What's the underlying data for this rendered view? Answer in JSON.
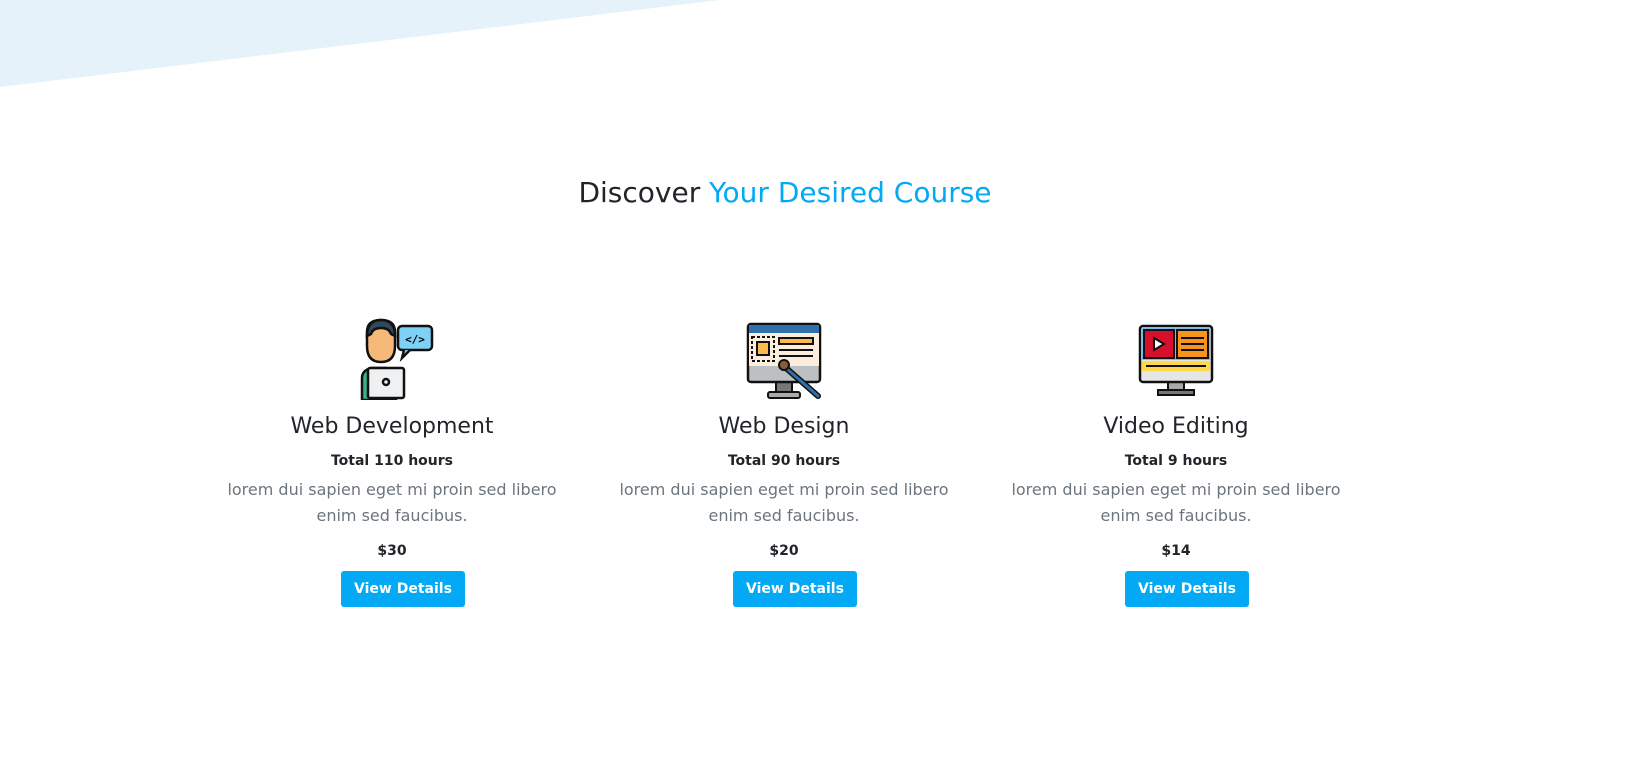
{
  "colors": {
    "accent": "#03a9f4",
    "background_shape": "#e6f2f9"
  },
  "section": {
    "title_plain": "Discover",
    "title_accent": "Your Desired Course"
  },
  "courses": [
    {
      "icon": "developer-laptop-icon",
      "title": "Web Development",
      "hours": "Total 110 hours",
      "description": "lorem dui sapien eget mi proin sed libero enim sed faucibus.",
      "price": "$30",
      "button": "View Details"
    },
    {
      "icon": "web-design-monitor-icon",
      "title": "Web Design",
      "hours": "Total 90 hours",
      "description": "lorem dui sapien eget mi proin sed libero enim sed faucibus.",
      "price": "$20",
      "button": "View Details"
    },
    {
      "icon": "video-editing-monitor-icon",
      "title": "Video Editing",
      "hours": "Total 9 hours",
      "description": "lorem dui sapien eget mi proin sed libero enim sed faucibus.",
      "price": "$14",
      "button": "View Details"
    }
  ]
}
